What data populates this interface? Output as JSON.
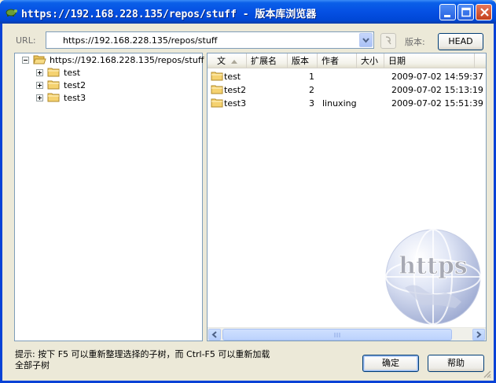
{
  "window": {
    "title": "https://192.168.228.135/repos/stuff - 版本库浏览器"
  },
  "toolbar": {
    "url_label": "URL:",
    "url_value": "https://192.168.228.135/repos/stuff",
    "revision_label": "版本:",
    "revision_button": "HEAD"
  },
  "tree": {
    "root": "https://192.168.228.135/repos/stuff",
    "children": [
      {
        "label": "test"
      },
      {
        "label": "test2"
      },
      {
        "label": "test3"
      }
    ]
  },
  "list": {
    "columns": [
      "文",
      "扩展名",
      "版本",
      "作者",
      "大小",
      "日期"
    ],
    "rows": [
      {
        "name": "test",
        "ext": "",
        "revision": "1",
        "author": "",
        "size": "",
        "date": "2009-07-02 14:59:37"
      },
      {
        "name": "test2",
        "ext": "",
        "revision": "2",
        "author": "",
        "size": "",
        "date": "2009-07-02 15:13:19"
      },
      {
        "name": "test3",
        "ext": "",
        "revision": "3",
        "author": "linuxing",
        "size": "",
        "date": "2009-07-02 15:51:39"
      }
    ],
    "watermark": "https"
  },
  "footer": {
    "hint": "提示: 按下 F5 可以重新整理选择的子树，而 Ctrl-F5 可以重新加载全部子树",
    "ok_button": "确定",
    "help_button": "帮助"
  },
  "colors": {
    "titlebar": "#0550e3",
    "folder": "#f5d270"
  }
}
